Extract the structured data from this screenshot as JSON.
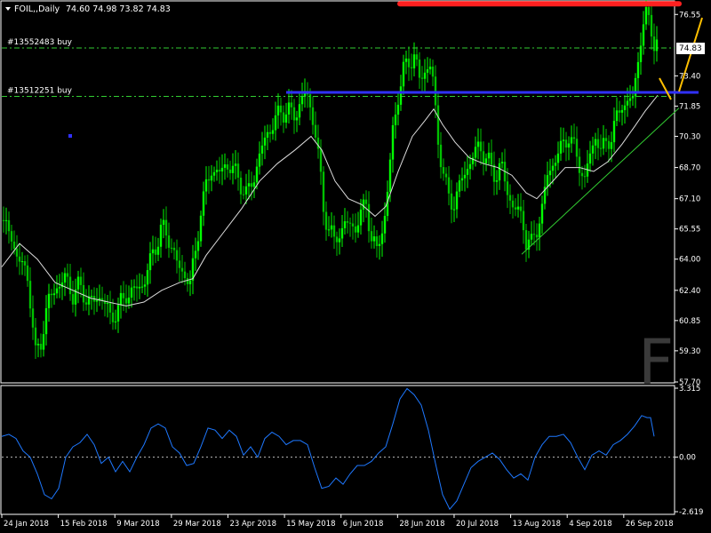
{
  "colors": {
    "background": "#000000",
    "frame": "#ffffff",
    "bull_candle": "#00ff00",
    "bear_candle": "#00c000",
    "moving_average": "#dcdcdc",
    "order_line": "#32cd32",
    "resistance_line": "#ff2020",
    "support_line": "#3030ff",
    "trend_line": "#32cd32",
    "arrow": "#ffc000",
    "oscillator": "#1e78ff",
    "axis_text": "#ffffff",
    "current_price_bg": "#ffffff",
    "current_price_text": "#000000"
  },
  "header": {
    "symbol_label": "FOIL,,Daily",
    "ohlc_text": "74.60 74.98 73.82 74.83"
  },
  "orders": [
    {
      "label": "#13552483 buy",
      "price": 74.83
    },
    {
      "label": "#13512251 buy",
      "price": 72.35
    }
  ],
  "current_price_label": "74.83",
  "watermark_letter": "F",
  "chart_data": [
    {
      "type": "candlestick",
      "title": "FOIL,,Daily",
      "ylim": [
        57.7,
        77.2
      ],
      "ytick_labels": [
        "76.55",
        "73.40",
        "71.85",
        "70.30",
        "68.70",
        "67.10",
        "65.55",
        "64.00",
        "62.40",
        "60.85",
        "59.30",
        "57.70"
      ],
      "xtick_labels": [
        "24 Jan 2018",
        "15 Feb 2018",
        "9 Mar 2018",
        "29 Mar 2018",
        "23 Apr 2018",
        "15 May 2018",
        "6 Jun 2018",
        "28 Jun 2018",
        "20 Jul 2018",
        "13 Aug 2018",
        "4 Sep 2018",
        "26 Sep 2018"
      ],
      "close_path": [
        [
          0,
          66.0
        ],
        [
          10,
          65.2
        ],
        [
          18,
          64.1
        ],
        [
          30,
          63.0
        ],
        [
          38,
          59.0
        ],
        [
          44,
          59.8
        ],
        [
          52,
          61.8
        ],
        [
          62,
          62.6
        ],
        [
          72,
          63.0
        ],
        [
          80,
          62.2
        ],
        [
          88,
          62.6
        ],
        [
          96,
          61.9
        ],
        [
          104,
          61.8
        ],
        [
          112,
          62.2
        ],
        [
          122,
          61.0
        ],
        [
          132,
          61.5
        ],
        [
          140,
          62.2
        ],
        [
          150,
          62.4
        ],
        [
          160,
          62.8
        ],
        [
          170,
          64.3
        ],
        [
          180,
          65.6
        ],
        [
          190,
          64.9
        ],
        [
          198,
          63.6
        ],
        [
          206,
          63.2
        ],
        [
          212,
          62.8
        ],
        [
          218,
          64.3
        ],
        [
          224,
          66.6
        ],
        [
          230,
          67.6
        ],
        [
          236,
          68.7
        ],
        [
          244,
          68.3
        ],
        [
          252,
          68.9
        ],
        [
          260,
          68.6
        ],
        [
          268,
          68.0
        ],
        [
          276,
          67.2
        ],
        [
          284,
          68.3
        ],
        [
          292,
          69.6
        ],
        [
          300,
          70.6
        ],
        [
          308,
          71.1
        ],
        [
          314,
          71.6
        ],
        [
          322,
          71.6
        ],
        [
          330,
          71.3
        ],
        [
          336,
          72.1
        ],
        [
          342,
          72.6
        ],
        [
          348,
          71.6
        ],
        [
          352,
          70.9
        ],
        [
          357,
          68.9
        ],
        [
          362,
          66.6
        ],
        [
          368,
          65.6
        ],
        [
          374,
          64.9
        ],
        [
          380,
          65.3
        ],
        [
          386,
          65.9
        ],
        [
          392,
          65.6
        ],
        [
          398,
          65.8
        ],
        [
          404,
          66.1
        ],
        [
          410,
          67.1
        ],
        [
          416,
          64.9
        ],
        [
          422,
          64.5
        ],
        [
          428,
          65.5
        ],
        [
          432,
          66.5
        ],
        [
          436,
          68.4
        ],
        [
          440,
          70.6
        ],
        [
          446,
          72.4
        ],
        [
          452,
          73.6
        ],
        [
          458,
          74.2
        ],
        [
          464,
          74.4
        ],
        [
          470,
          73.2
        ],
        [
          476,
          73.7
        ],
        [
          482,
          73.9
        ],
        [
          486,
          72.9
        ],
        [
          490,
          70.3
        ],
        [
          496,
          68.7
        ],
        [
          502,
          67.1
        ],
        [
          508,
          66.9
        ],
        [
          514,
          67.5
        ],
        [
          520,
          68.4
        ],
        [
          526,
          68.9
        ],
        [
          532,
          69.4
        ],
        [
          538,
          69.9
        ],
        [
          544,
          69.2
        ],
        [
          550,
          68.7
        ],
        [
          556,
          68.3
        ],
        [
          562,
          68.9
        ],
        [
          568,
          67.5
        ],
        [
          574,
          66.9
        ],
        [
          580,
          66.4
        ],
        [
          586,
          66.1
        ],
        [
          590,
          65.0
        ],
        [
          596,
          64.7
        ],
        [
          602,
          65.6
        ],
        [
          608,
          66.6
        ],
        [
          614,
          68.3
        ],
        [
          620,
          68.9
        ],
        [
          626,
          69.4
        ],
        [
          632,
          69.9
        ],
        [
          638,
          70.4
        ],
        [
          644,
          69.6
        ],
        [
          650,
          68.9
        ],
        [
          656,
          68.0
        ],
        [
          662,
          69.4
        ],
        [
          668,
          70.3
        ],
        [
          674,
          69.6
        ],
        [
          680,
          69.9
        ],
        [
          686,
          70.4
        ],
        [
          692,
          71.1
        ],
        [
          698,
          72.1
        ],
        [
          704,
          71.9
        ],
        [
          710,
          72.3
        ],
        [
          714,
          73.6
        ],
        [
          718,
          75.0
        ],
        [
          722,
          75.9
        ],
        [
          726,
          76.6
        ],
        [
          730,
          76.3
        ],
        [
          734,
          75.0
        ],
        [
          738,
          74.8
        ]
      ],
      "moving_average": [
        [
          0,
          63.6
        ],
        [
          20,
          64.8
        ],
        [
          40,
          64.0
        ],
        [
          60,
          62.8
        ],
        [
          80,
          62.4
        ],
        [
          100,
          62.0
        ],
        [
          120,
          61.8
        ],
        [
          140,
          61.6
        ],
        [
          160,
          61.8
        ],
        [
          180,
          62.4
        ],
        [
          200,
          62.8
        ],
        [
          215,
          63.0
        ],
        [
          230,
          64.2
        ],
        [
          250,
          65.4
        ],
        [
          270,
          66.6
        ],
        [
          290,
          68.0
        ],
        [
          310,
          68.9
        ],
        [
          330,
          69.6
        ],
        [
          348,
          70.3
        ],
        [
          360,
          69.6
        ],
        [
          375,
          68.0
        ],
        [
          390,
          67.1
        ],
        [
          405,
          66.8
        ],
        [
          420,
          66.2
        ],
        [
          432,
          66.7
        ],
        [
          446,
          68.5
        ],
        [
          462,
          70.3
        ],
        [
          476,
          71.1
        ],
        [
          486,
          71.7
        ],
        [
          496,
          70.9
        ],
        [
          510,
          70.0
        ],
        [
          526,
          69.2
        ],
        [
          542,
          68.9
        ],
        [
          558,
          68.7
        ],
        [
          574,
          68.3
        ],
        [
          590,
          67.4
        ],
        [
          602,
          67.1
        ],
        [
          618,
          67.9
        ],
        [
          634,
          68.7
        ],
        [
          650,
          68.7
        ],
        [
          666,
          68.5
        ],
        [
          682,
          69.0
        ],
        [
          698,
          69.9
        ],
        [
          712,
          70.8
        ],
        [
          724,
          71.6
        ],
        [
          738,
          72.4
        ]
      ],
      "resistance_price": 77.1,
      "support_price": 72.55,
      "trend_line": [
        [
          585,
          64.25
        ],
        [
          762,
          71.75
        ]
      ],
      "oscillator": {
        "ylim": [
          -2.619,
          3.315
        ],
        "ytick_labels": [
          "3.315",
          "0.00",
          "-2.619"
        ],
        "zero_line": 0,
        "values": [
          [
            0,
            1.0
          ],
          [
            8,
            1.1
          ],
          [
            16,
            0.9
          ],
          [
            24,
            0.3
          ],
          [
            32,
            0.0
          ],
          [
            40,
            -0.8
          ],
          [
            48,
            -1.8
          ],
          [
            56,
            -2.0
          ],
          [
            64,
            -1.5
          ],
          [
            72,
            0.0
          ],
          [
            80,
            0.5
          ],
          [
            88,
            0.7
          ],
          [
            96,
            1.1
          ],
          [
            104,
            0.6
          ],
          [
            112,
            -0.3
          ],
          [
            120,
            0.0
          ],
          [
            128,
            -0.7
          ],
          [
            136,
            -0.2
          ],
          [
            144,
            -0.7
          ],
          [
            152,
            0.0
          ],
          [
            160,
            0.6
          ],
          [
            168,
            1.4
          ],
          [
            176,
            1.6
          ],
          [
            184,
            1.4
          ],
          [
            192,
            0.5
          ],
          [
            200,
            0.2
          ],
          [
            208,
            -0.4
          ],
          [
            216,
            -0.3
          ],
          [
            224,
            0.5
          ],
          [
            232,
            1.4
          ],
          [
            240,
            1.3
          ],
          [
            248,
            0.9
          ],
          [
            256,
            1.3
          ],
          [
            264,
            1.0
          ],
          [
            272,
            0.1
          ],
          [
            280,
            0.5
          ],
          [
            288,
            0.0
          ],
          [
            296,
            0.9
          ],
          [
            304,
            1.2
          ],
          [
            312,
            1.0
          ],
          [
            320,
            0.6
          ],
          [
            328,
            0.8
          ],
          [
            336,
            0.8
          ],
          [
            344,
            0.6
          ],
          [
            352,
            -0.5
          ],
          [
            360,
            -1.5
          ],
          [
            368,
            -1.4
          ],
          [
            376,
            -1.0
          ],
          [
            384,
            -1.3
          ],
          [
            392,
            -0.8
          ],
          [
            400,
            -0.4
          ],
          [
            408,
            -0.4
          ],
          [
            416,
            -0.2
          ],
          [
            424,
            0.2
          ],
          [
            432,
            0.5
          ],
          [
            440,
            1.6
          ],
          [
            448,
            2.8
          ],
          [
            456,
            3.3
          ],
          [
            464,
            3.0
          ],
          [
            472,
            2.5
          ],
          [
            480,
            1.3
          ],
          [
            488,
            -0.3
          ],
          [
            496,
            -1.8
          ],
          [
            504,
            -2.5
          ],
          [
            512,
            -2.1
          ],
          [
            520,
            -1.3
          ],
          [
            528,
            -0.5
          ],
          [
            536,
            -0.2
          ],
          [
            544,
            0.0
          ],
          [
            552,
            0.2
          ],
          [
            560,
            -0.1
          ],
          [
            568,
            -0.6
          ],
          [
            576,
            -1.0
          ],
          [
            584,
            -0.8
          ],
          [
            592,
            -1.1
          ],
          [
            600,
            0.0
          ],
          [
            608,
            0.6
          ],
          [
            616,
            1.0
          ],
          [
            624,
            1.0
          ],
          [
            632,
            1.1
          ],
          [
            640,
            0.7
          ],
          [
            648,
            0.0
          ],
          [
            656,
            -0.6
          ],
          [
            664,
            0.1
          ],
          [
            672,
            0.3
          ],
          [
            680,
            0.1
          ],
          [
            688,
            0.6
          ],
          [
            696,
            0.8
          ],
          [
            704,
            1.1
          ],
          [
            712,
            1.5
          ],
          [
            720,
            2.0
          ],
          [
            726,
            1.9
          ],
          [
            730,
            1.9
          ],
          [
            734,
            1.0
          ]
        ]
      }
    }
  ]
}
